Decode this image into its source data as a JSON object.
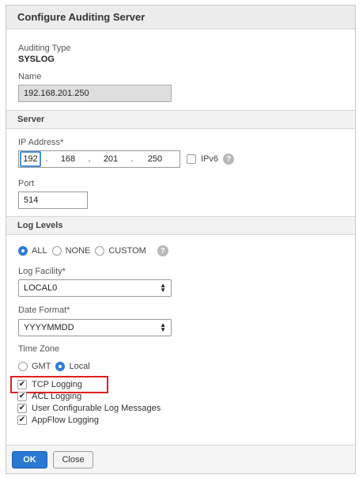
{
  "dialog": {
    "title": "Configure Auditing Server"
  },
  "auditing": {
    "type_label": "Auditing Type",
    "type_value": "SYSLOG",
    "name_label": "Name",
    "name_value": "192.168.201.250"
  },
  "server": {
    "section_title": "Server",
    "ip_label": "IP Address*",
    "ip_octets": [
      "192",
      "168",
      "201",
      "250"
    ],
    "ipv6_label": "IPv6",
    "port_label": "Port",
    "port_value": "514"
  },
  "log_levels": {
    "section_title": "Log Levels",
    "options": [
      {
        "label": "ALL",
        "selected": true
      },
      {
        "label": "NONE",
        "selected": false
      },
      {
        "label": "CUSTOM",
        "selected": false
      }
    ],
    "facility_label": "Log Facility*",
    "facility_value": "LOCAL0",
    "date_format_label": "Date Format*",
    "date_format_value": "YYYYMMDD",
    "timezone_label": "Time Zone",
    "timezone_options": [
      {
        "label": "GMT",
        "selected": false
      },
      {
        "label": "Local",
        "selected": true
      }
    ],
    "checkboxes": [
      {
        "label": "TCP Logging",
        "checked": true
      },
      {
        "label": "ACL Logging",
        "checked": true
      },
      {
        "label": "User Configurable Log Messages",
        "checked": true
      },
      {
        "label": "AppFlow Logging",
        "checked": true
      }
    ]
  },
  "footer": {
    "ok_label": "OK",
    "close_label": "Close"
  },
  "colors": {
    "accent": "#2a78d2",
    "highlight": "#e02020"
  },
  "icons": {
    "help": "help-circle-icon",
    "check": "checkmark-icon",
    "select_arrows": "updown-arrows-icon"
  }
}
